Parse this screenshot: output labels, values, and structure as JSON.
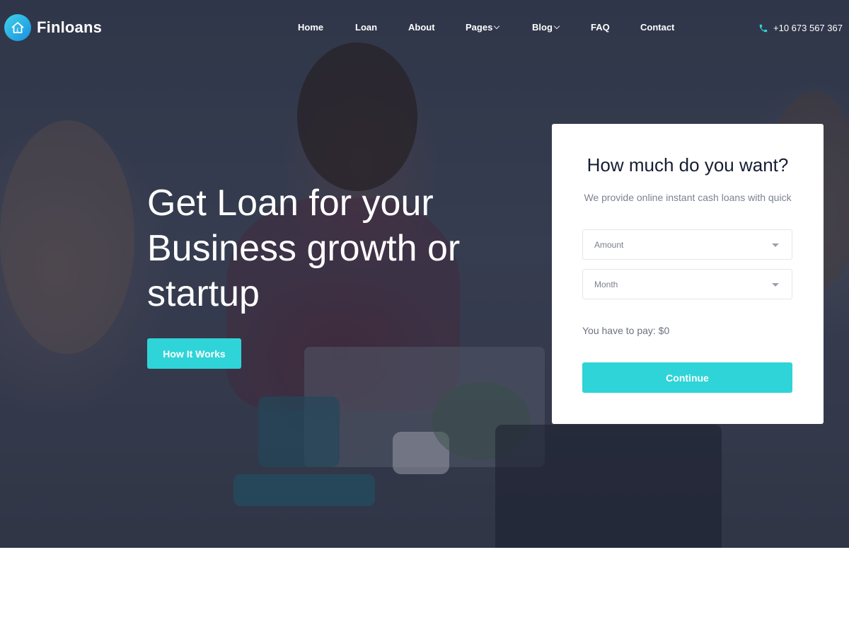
{
  "brand": {
    "name": "Finloans",
    "logo_icon": "house-icon",
    "accent": "#2fd4d8"
  },
  "nav": {
    "items": [
      {
        "label": "Home",
        "has_dropdown": false
      },
      {
        "label": "Loan",
        "has_dropdown": false
      },
      {
        "label": "About",
        "has_dropdown": false
      },
      {
        "label": "Pages",
        "has_dropdown": true
      },
      {
        "label": "Blog",
        "has_dropdown": true
      },
      {
        "label": "FAQ",
        "has_dropdown": false
      },
      {
        "label": "Contact",
        "has_dropdown": false
      }
    ]
  },
  "contact": {
    "phone": "+10 673 567 367",
    "icon": "phone-icon"
  },
  "hero": {
    "headline": "Get Loan for your Business growth or startup",
    "button_label": "How It Works"
  },
  "loan_form": {
    "title": "How much do you want?",
    "subtitle": "We provide online instant cash loans with quick",
    "amount_placeholder": "Amount",
    "month_placeholder": "Month",
    "pay_text": "You have to pay: $0",
    "submit_label": "Continue"
  }
}
